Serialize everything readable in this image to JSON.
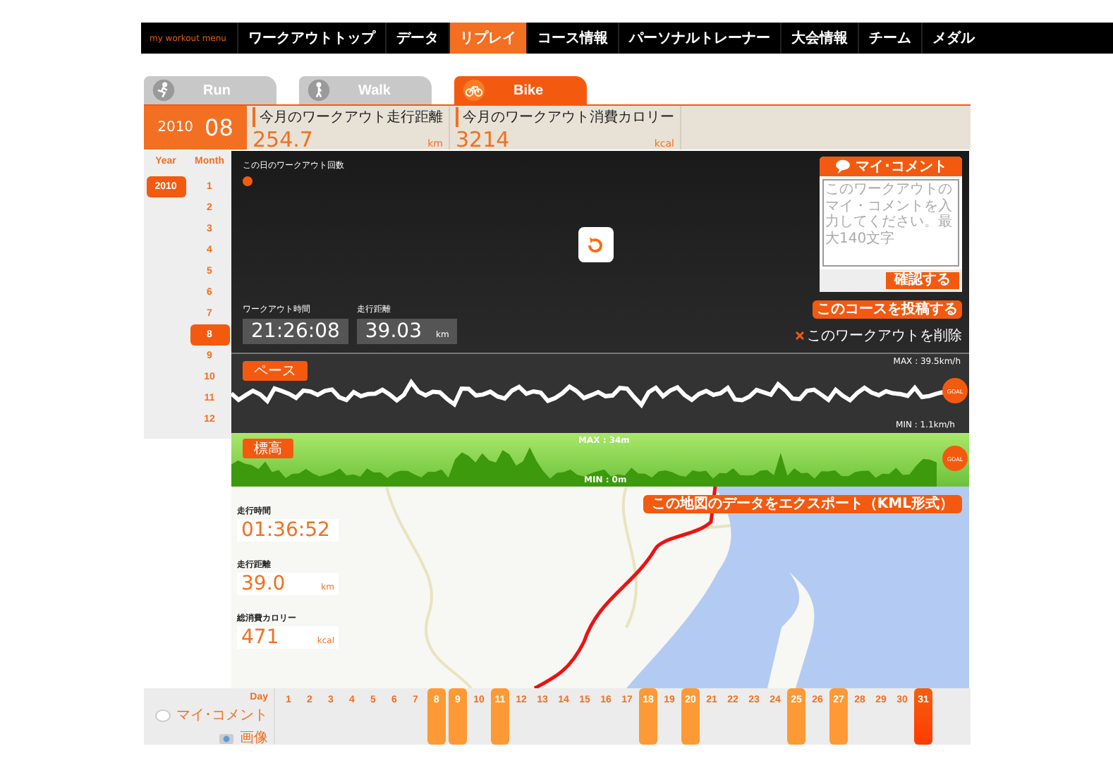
{
  "nav": {
    "logo": "my workout menu",
    "items": [
      {
        "label": "ワークアウトトップ",
        "selected": false
      },
      {
        "label": "データ",
        "selected": false
      },
      {
        "label": "リプレイ",
        "selected": true
      },
      {
        "label": "コース情報",
        "selected": false
      },
      {
        "label": "パーソナルトレーナー",
        "selected": false
      },
      {
        "label": "大会情報",
        "selected": false
      },
      {
        "label": "チーム",
        "selected": false
      },
      {
        "label": "メダル",
        "selected": false
      }
    ]
  },
  "sport_tabs": [
    {
      "label": "Run",
      "kind": "run",
      "selected": false
    },
    {
      "label": "Walk",
      "kind": "walk",
      "selected": false
    },
    {
      "label": "Bike",
      "kind": "bike",
      "selected": true
    }
  ],
  "period": {
    "year": "2010",
    "month": "08"
  },
  "monthly_stats": [
    {
      "label": "今月のワークアウト走行距離",
      "value": "254.7",
      "unit": "km"
    },
    {
      "label": "今月のワークアウト消費カロリー",
      "value": "3214",
      "unit": "kcal"
    }
  ],
  "year_header": "Year",
  "month_header": "Month",
  "years": [
    {
      "label": "2010",
      "selected": true
    }
  ],
  "months": [
    {
      "label": "1",
      "selected": false
    },
    {
      "label": "2",
      "selected": false
    },
    {
      "label": "3",
      "selected": false
    },
    {
      "label": "4",
      "selected": false
    },
    {
      "label": "5",
      "selected": false
    },
    {
      "label": "6",
      "selected": false
    },
    {
      "label": "7",
      "selected": false
    },
    {
      "label": "8",
      "selected": true
    },
    {
      "label": "9",
      "selected": false
    },
    {
      "label": "10",
      "selected": false
    },
    {
      "label": "11",
      "selected": false
    },
    {
      "label": "12",
      "selected": false
    }
  ],
  "workout_count_label": "この日のワークアウト回数",
  "summary": [
    {
      "label": "ワークアウト時間",
      "value": "21:26:08"
    },
    {
      "label": "走行距離",
      "value": "39.03",
      "unit": "km"
    }
  ],
  "comment": {
    "title": "マイ･コメント",
    "placeholder": "このワークアウトのマイ・コメントを入力してください。最大140文字",
    "button": "確認する"
  },
  "post_button": "このコースを投稿する",
  "delete_link": "このワークアウトを削除",
  "pace": {
    "label": "ペース",
    "max": "MAX : 39.5km/h",
    "min": "MIN : 1.1km/h",
    "goal": "GOAL"
  },
  "elevation": {
    "label": "標高",
    "max": "MAX : 34m",
    "min": "MIN : 0m",
    "goal": "GOAL"
  },
  "map_stats": [
    {
      "label": "走行時間",
      "value": "01:36:52"
    },
    {
      "label": "走行距離",
      "value": "39.0",
      "unit": "km"
    },
    {
      "label": "総消費カロリー",
      "value": "471",
      "unit": "kcal"
    }
  ],
  "export_button": "この地図のデータをエクスポート（KML形式）",
  "day_header": "Day",
  "legend": [
    {
      "label": "マイ･コメント",
      "kind": "comment"
    },
    {
      "label": "画像",
      "kind": "image"
    }
  ],
  "days": [
    {
      "label": "1",
      "workout": false,
      "selected": false
    },
    {
      "label": "2",
      "workout": false,
      "selected": false
    },
    {
      "label": "3",
      "workout": false,
      "selected": false
    },
    {
      "label": "4",
      "workout": false,
      "selected": false
    },
    {
      "label": "5",
      "workout": false,
      "selected": false
    },
    {
      "label": "6",
      "workout": false,
      "selected": false
    },
    {
      "label": "7",
      "workout": false,
      "selected": false
    },
    {
      "label": "8",
      "workout": true,
      "selected": false
    },
    {
      "label": "9",
      "workout": true,
      "selected": false
    },
    {
      "label": "10",
      "workout": false,
      "selected": false
    },
    {
      "label": "11",
      "workout": true,
      "selected": false
    },
    {
      "label": "12",
      "workout": false,
      "selected": false
    },
    {
      "label": "13",
      "workout": false,
      "selected": false
    },
    {
      "label": "14",
      "workout": false,
      "selected": false
    },
    {
      "label": "15",
      "workout": false,
      "selected": false
    },
    {
      "label": "16",
      "workout": false,
      "selected": false
    },
    {
      "label": "17",
      "workout": false,
      "selected": false
    },
    {
      "label": "18",
      "workout": true,
      "selected": false
    },
    {
      "label": "19",
      "workout": false,
      "selected": false
    },
    {
      "label": "20",
      "workout": true,
      "selected": false
    },
    {
      "label": "21",
      "workout": false,
      "selected": false
    },
    {
      "label": "22",
      "workout": false,
      "selected": false
    },
    {
      "label": "23",
      "workout": false,
      "selected": false
    },
    {
      "label": "24",
      "workout": false,
      "selected": false
    },
    {
      "label": "25",
      "workout": true,
      "selected": false
    },
    {
      "label": "26",
      "workout": false,
      "selected": false
    },
    {
      "label": "27",
      "workout": true,
      "selected": false
    },
    {
      "label": "28",
      "workout": false,
      "selected": false
    },
    {
      "label": "29",
      "workout": false,
      "selected": false
    },
    {
      "label": "30",
      "workout": false,
      "selected": false
    },
    {
      "label": "31",
      "workout": true,
      "selected": true
    }
  ]
}
